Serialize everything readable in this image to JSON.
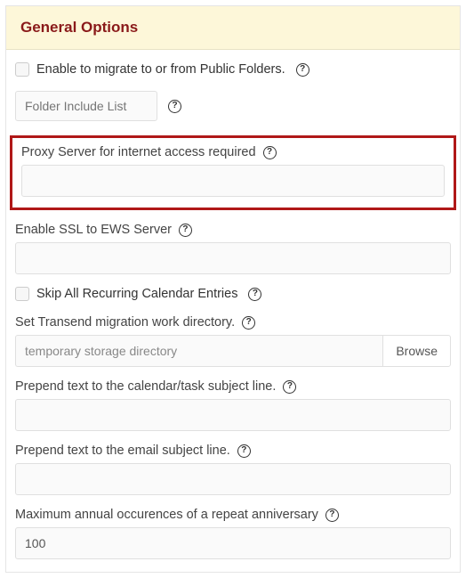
{
  "header": {
    "title": "General Options"
  },
  "enablePublic": {
    "label": "Enable to migrate to or from Public Folders."
  },
  "folderInclude": {
    "placeholder": "Folder Include List"
  },
  "proxyServer": {
    "label": "Proxy Server for internet access required"
  },
  "enableSSL": {
    "label": "Enable SSL to EWS Server"
  },
  "skipRecurring": {
    "label": "Skip All Recurring Calendar Entries"
  },
  "workDirectory": {
    "label": "Set Transend migration work directory.",
    "placeholder": "temporary storage directory",
    "browse": "Browse"
  },
  "prependCalendar": {
    "label": "Prepend text to the calendar/task subject line."
  },
  "prependEmail": {
    "label": "Prepend text to the email subject line."
  },
  "maxOccurrences": {
    "label": "Maximum annual occurences of a repeat anniversary",
    "value": "100"
  }
}
